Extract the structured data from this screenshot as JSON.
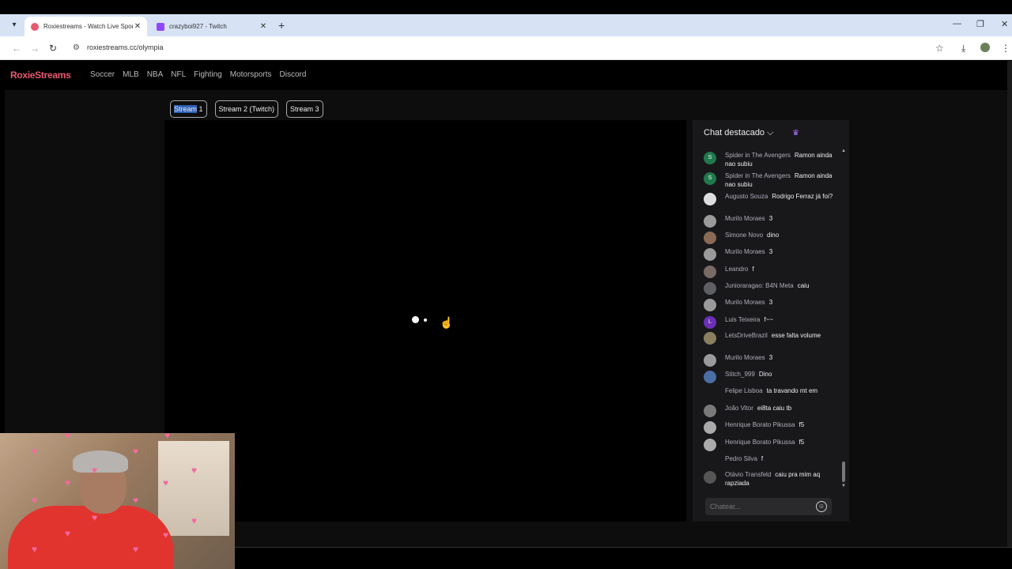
{
  "browser": {
    "tabs": [
      {
        "title": "Roxiestreams - Watch Live Spor",
        "active": true,
        "favicon_color": "#e85a6e"
      },
      {
        "title": "crazyboi927 - Twitch",
        "active": false,
        "favicon_color": "#9146ff"
      }
    ],
    "url": "roxiestreams.cc/olympia"
  },
  "site": {
    "logo": "RoxieStreams",
    "nav": [
      "Soccer",
      "MLB",
      "NBA",
      "NFL",
      "Fighting",
      "Motorsports",
      "Discord"
    ],
    "stream_buttons": {
      "s1_selected": "Stream",
      "s1_rest": " 1",
      "s2": "Stream 2 (Twitch)",
      "s3": "Stream 3"
    }
  },
  "chat": {
    "header": "Chat destacado",
    "input_placeholder": "Chatear...",
    "messages": [
      {
        "user": "Spider in The Avengers",
        "text": "Ramon ainda nao subiu",
        "avatar": "S",
        "color": "#1f7a4d"
      },
      {
        "user": "Spider in The Avengers",
        "text": "Ramon ainda nao subiu",
        "avatar": "S",
        "color": "#1f7a4d"
      },
      {
        "user": "Augusto Souza",
        "text": "Rodrigo Ferraz já foi?",
        "avatar": "",
        "color": "#ddd"
      },
      {
        "user": "Murilo Moraes",
        "text": "3",
        "avatar": "",
        "color": "#9a9a9a"
      },
      {
        "user": "Simone Novo",
        "text": "dino",
        "avatar": "",
        "color": "#8a6a55"
      },
      {
        "user": "Murilo Moraes",
        "text": "3",
        "avatar": "",
        "color": "#9a9a9a"
      },
      {
        "user": "Leandro",
        "text": "f",
        "avatar": "",
        "color": "#7a6a66"
      },
      {
        "user": "Junioraragao: B4N Meta",
        "text": "caiu",
        "avatar": "",
        "color": "#5f5f66"
      },
      {
        "user": "Murilo Moraes",
        "text": "3",
        "avatar": "",
        "color": "#9a9a9a"
      },
      {
        "user": "Luis Teixeira",
        "text": "f~~",
        "avatar": "L",
        "color": "#6a2fb6"
      },
      {
        "user": "LetsDriveBrazil",
        "text": "esse falta volume",
        "avatar": "",
        "color": "#8a8060"
      },
      {
        "user": "Murilo Moraes",
        "text": "3",
        "avatar": "",
        "color": "#9a9a9a"
      },
      {
        "user": "Stitch_999",
        "text": "Dino",
        "avatar": "",
        "color": "#4a6fa5"
      },
      {
        "user": "Felipe Lisboa",
        "text": "ta travando mt em",
        "avatar": "",
        "color": "#18181b"
      },
      {
        "user": "João Vitor",
        "text": "ei8ta caiu tb",
        "avatar": "",
        "color": "#7a7a7a"
      },
      {
        "user": "Henrique Borato Pikussa",
        "text": "f5",
        "avatar": "",
        "color": "#aaa"
      },
      {
        "user": "Henrique Borato Pikussa",
        "text": "f5",
        "avatar": "",
        "color": "#aaa"
      },
      {
        "user": "Pedro Silva",
        "text": "f",
        "avatar": "",
        "color": "#18181b"
      },
      {
        "user": "Otávio Transfeld",
        "text": "caiu pra mim aq rapziada",
        "avatar": "",
        "color": "#555"
      }
    ]
  },
  "colors": {
    "accent": "#e85a6e",
    "selection": "#2f5fb8",
    "chat_bg": "#18181b"
  }
}
